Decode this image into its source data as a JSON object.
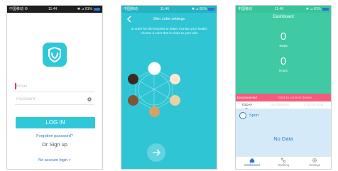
{
  "status": {
    "login": {
      "left": "中国移动 ⊕",
      "time": "11:44",
      "right": "✱ ⊿ 81%"
    },
    "skin": {
      "left": "中国移动",
      "time": "11:46",
      "right": "✱ ⊿ 81%"
    },
    "dash": {
      "left": "中国移动",
      "time": "11:48",
      "right": "✱ ⊿ 81%"
    }
  },
  "login": {
    "email_placeholder": "Email",
    "password_placeholder": "Password",
    "login_button": "LOG IN",
    "forgot": "Forgotten password?",
    "signup": "Or Sign up",
    "no_account": "No account login  >"
  },
  "skin": {
    "title": "Skin color settings",
    "description": "In order for the bracelet to better monitor your health, choose a color that is close to your skin",
    "swatches": [
      {
        "color": "#ffffff",
        "selected": true
      },
      {
        "color": "#fbe8cf"
      },
      {
        "color": "#e9d1a3"
      },
      {
        "color": "#d4a265"
      },
      {
        "color": "#7e5634"
      },
      {
        "color": "#3d2a1f"
      }
    ]
  },
  "dash": {
    "title": "Dashboard",
    "steps_value": "0",
    "steps_unit": "Steps",
    "hours_value": "0",
    "hours_unit": "Hours",
    "disconnected": "Disconnected",
    "connect_hint": "Click to connect device",
    "tabs": [
      "TODAY",
      "YESTERDAY",
      "2 DAYS AGO"
    ],
    "sport": "Sport",
    "no_data": "No Data",
    "nav": [
      "Dashboard",
      "Ranking",
      "Settings"
    ]
  },
  "colors": {
    "accent": "#2ec8d8",
    "dash_green": "#3fcaa3",
    "disconnect_pink": "#f25d7c",
    "link_blue": "#2b78c6"
  }
}
